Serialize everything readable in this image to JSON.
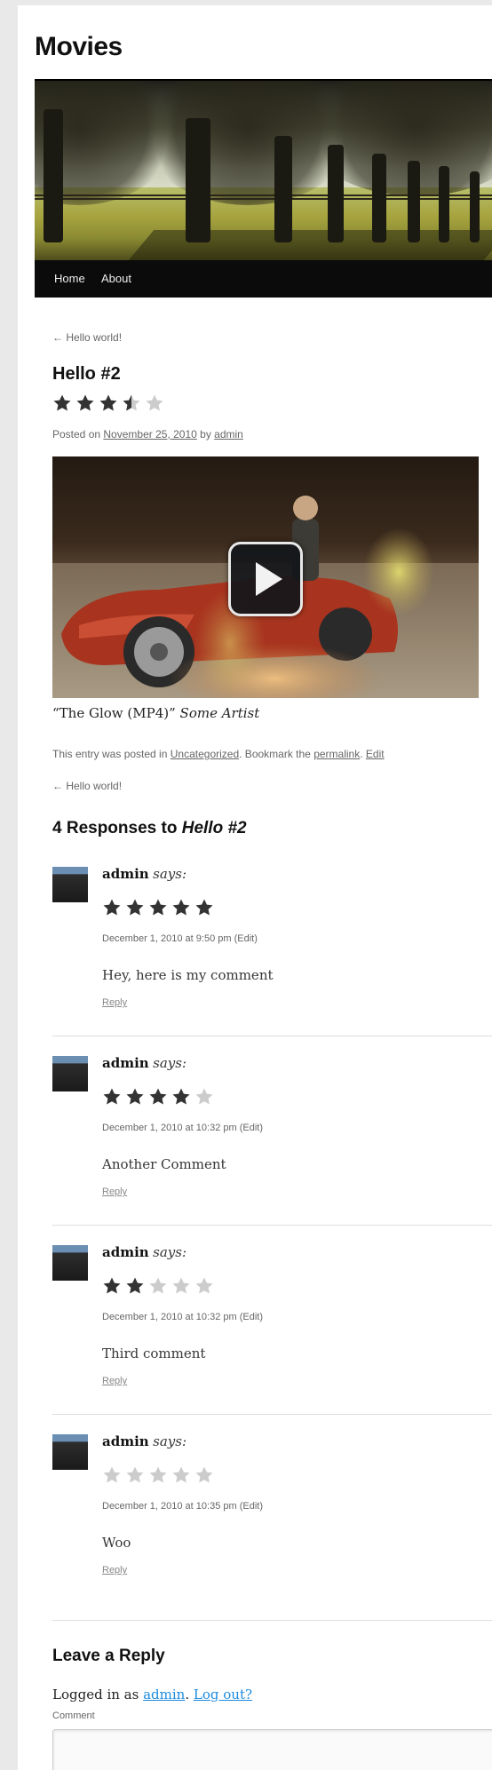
{
  "site": {
    "title": "Movies"
  },
  "nav": {
    "items": [
      {
        "label": "Home"
      },
      {
        "label": "About"
      }
    ]
  },
  "post_nav": {
    "previous_top": "← Hello world!",
    "previous_bottom": "← Hello world!"
  },
  "post": {
    "title": "Hello #2",
    "rating": {
      "value": 3.5,
      "max": 5
    },
    "meta": {
      "prefix": "Posted on",
      "date": "November 25, 2010",
      "by": "by",
      "author": "admin"
    },
    "video": {
      "play_icon": "play-icon"
    },
    "caption": {
      "title": "“The Glow (MP4)”",
      "artist": "Some Artist"
    },
    "footer": {
      "prefix": "This entry was posted in",
      "category": "Uncategorized",
      "bookmark": ". Bookmark the",
      "permalink": "permalink",
      "dot": ".",
      "edit": "Edit"
    }
  },
  "comments_section": {
    "heading_prefix": "4 Responses to",
    "heading_title": "Hello #2",
    "comments": [
      {
        "author": "admin",
        "says": "says:",
        "rating": 5,
        "datetime": "December 1, 2010 at 9:50 pm",
        "edit": "(Edit)",
        "text": "Hey, here is my comment",
        "reply": "Reply"
      },
      {
        "author": "admin",
        "says": "says:",
        "rating": 4,
        "datetime": "December 1, 2010 at 10:32 pm",
        "edit": "(Edit)",
        "text": "Another Comment",
        "reply": "Reply"
      },
      {
        "author": "admin",
        "says": "says:",
        "rating": 2,
        "datetime": "December 1, 2010 at 10:32 pm",
        "edit": "(Edit)",
        "text": "Third comment",
        "reply": "Reply"
      },
      {
        "author": "admin",
        "says": "says:",
        "rating": 0,
        "datetime": "December 1, 2010 at 10:35 pm",
        "edit": "(Edit)",
        "text": "Woo",
        "reply": "Reply"
      }
    ]
  },
  "reply_form": {
    "heading": "Leave a Reply",
    "logged_in_prefix": "Logged in as",
    "user": "admin",
    "period": ".",
    "logout": "Log out?",
    "comment_label": "Comment"
  },
  "colors": {
    "star_filled": "#333333",
    "star_empty": "#cccccc",
    "link": "#1b8be0",
    "nav_bg": "#0b0b0b"
  }
}
